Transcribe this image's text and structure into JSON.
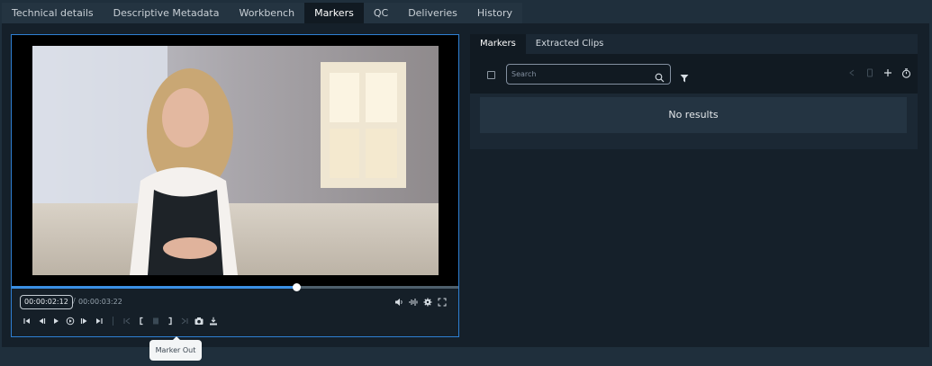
{
  "tabs": [
    {
      "label": "Technical details",
      "active": false
    },
    {
      "label": "Descriptive Metadata",
      "active": false
    },
    {
      "label": "Workbench",
      "active": false
    },
    {
      "label": "Markers",
      "active": true
    },
    {
      "label": "QC",
      "active": false
    },
    {
      "label": "Deliveries",
      "active": false
    },
    {
      "label": "History",
      "active": false
    }
  ],
  "player": {
    "current_time": "00:00:02:12",
    "separator": "/",
    "duration": "00:00:03:22",
    "progress_fraction": 0.638,
    "right_controls": [
      "volume-icon",
      "waveform-icon",
      "settings-gear-icon",
      "fullscreen-icon"
    ],
    "transport_controls": [
      "skip-to-start-icon",
      "step-back-icon",
      "play-icon",
      "loop-icon",
      "step-forward-icon",
      "skip-to-end-icon",
      "go-to-marker-in-icon",
      "marker-in-icon",
      "marker-icon",
      "marker-out-icon",
      "go-to-marker-out-icon",
      "snapshot-camera-icon",
      "export-download-icon"
    ],
    "tooltip": "Marker Out"
  },
  "side_panel": {
    "tabs": [
      {
        "label": "Markers",
        "active": true
      },
      {
        "label": "Extracted Clips",
        "active": false
      }
    ],
    "search": {
      "placeholder": "Search",
      "value": ""
    },
    "empty_text": "No results",
    "toolbar_icons": [
      "prev-disabled-icon",
      "delete-disabled-icon",
      "add-icon",
      "timer-icon"
    ]
  },
  "colors": {
    "accent": "#3a8fe3",
    "background": "#1f2f3c",
    "panel": "#15202a"
  }
}
